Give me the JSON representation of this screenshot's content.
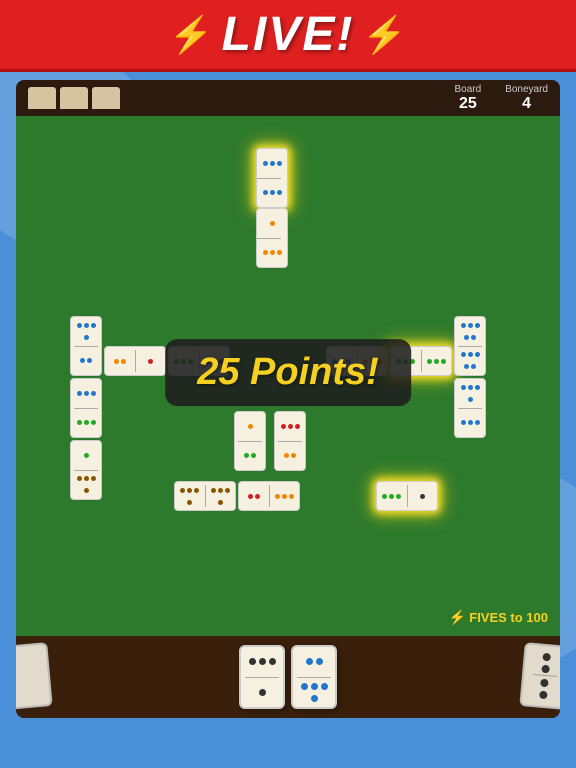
{
  "header": {
    "live_label": "LIVE!",
    "lightning_left": "⚡",
    "lightning_right": "⚡"
  },
  "info_bar": {
    "board_label": "Board",
    "board_value": "25",
    "boneyard_label": "Boneyard",
    "boneyard_value": "4"
  },
  "points_popup": {
    "text": "25 Points!"
  },
  "fives_indicator": {
    "bolt": "⚡",
    "text": "FIVES to 100"
  },
  "colors": {
    "header_bg": "#e02020",
    "felt": "#2d7a2d",
    "tray": "#3a1f0a"
  }
}
